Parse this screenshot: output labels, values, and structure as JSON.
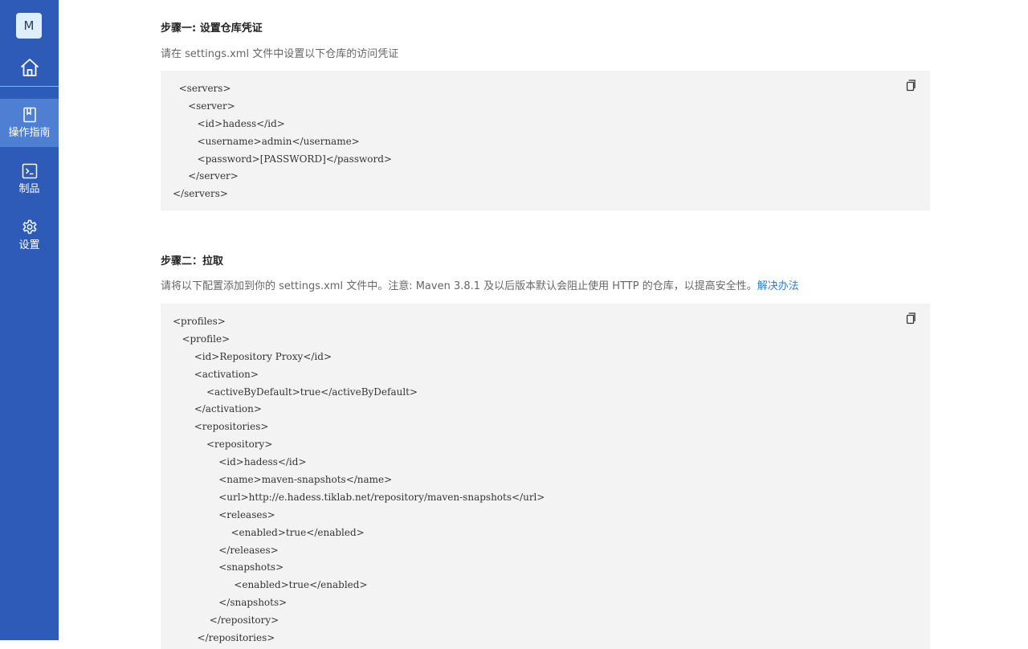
{
  "sidebar": {
    "avatar_letter": "M",
    "items": [
      {
        "label": "操作指南",
        "icon": "book-icon",
        "active": true
      },
      {
        "label": "制品",
        "icon": "terminal-icon",
        "active": false
      },
      {
        "label": "设置",
        "icon": "gear-icon",
        "active": false
      }
    ]
  },
  "step1": {
    "title": "步骤一: 设置仓库凭证",
    "description": "请在 settings.xml 文件中设置以下仓库的访问凭证",
    "code": [
      "  <servers>",
      "     <server>",
      "        <id>hadess</id>",
      "        <username>admin</username>",
      "        <password>[PASSWORD]</password>",
      "     </server>",
      "</servers>"
    ]
  },
  "step2": {
    "title": "步骤二：拉取",
    "description": "请将以下配置添加到你的 settings.xml 文件中。注意: Maven 3.8.1 及以后版本默认会阻止使用 HTTP 的仓库，以提高安全性。",
    "link": "解决办法",
    "code": [
      "<profiles>",
      "   <profile>",
      "       <id>Repository Proxy</id>",
      "       <activation>",
      "           <activeByDefault>true</activeByDefault>",
      "       </activation>",
      "       <repositories>",
      "           <repository>",
      "               <id>hadess</id>",
      "               <name>maven-snapshots</name>",
      "               <url>http://e.hadess.tiklab.net/repository/maven-snapshots</url>",
      "               <releases>",
      "                   <enabled>true</enabled>",
      "               </releases>",
      "               <snapshots>",
      "                    <enabled>true</enabled>",
      "               </snapshots>",
      "            </repository>",
      "        </repositories>"
    ]
  },
  "colors": {
    "sidebar": "#2e5bb8",
    "sidebar_active": "#4f7fd3",
    "code_bg": "#f3f3f3",
    "link": "#2a7fd4"
  }
}
